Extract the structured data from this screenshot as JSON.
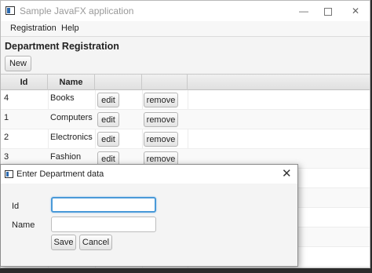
{
  "window": {
    "title": "Sample JavaFX application",
    "minimize_glyph": "—",
    "close_glyph": "✕"
  },
  "menu": {
    "items": [
      {
        "label": "Registration"
      },
      {
        "label": "Help"
      }
    ]
  },
  "page": {
    "title": "Department Registration",
    "new_label": "New"
  },
  "table": {
    "columns": [
      "Id",
      "Name",
      "",
      ""
    ],
    "rows": [
      {
        "id": "4",
        "name": "Books",
        "edit": "edit",
        "remove": "remove"
      },
      {
        "id": "1",
        "name": "Computers",
        "edit": "edit",
        "remove": "remove"
      },
      {
        "id": "2",
        "name": "Electronics",
        "edit": "edit",
        "remove": "remove"
      },
      {
        "id": "3",
        "name": "Fashion",
        "edit": "edit",
        "remove": "remove"
      }
    ]
  },
  "dialog": {
    "title": "Enter Department data",
    "close_glyph": "✕",
    "id_label": "Id",
    "name_label": "Name",
    "id_value": "",
    "name_value": "",
    "save_label": "Save",
    "cancel_label": "Cancel"
  },
  "colors": {
    "focus_ring": "#4a9ad8",
    "window_bg": "#f4f4f4"
  }
}
